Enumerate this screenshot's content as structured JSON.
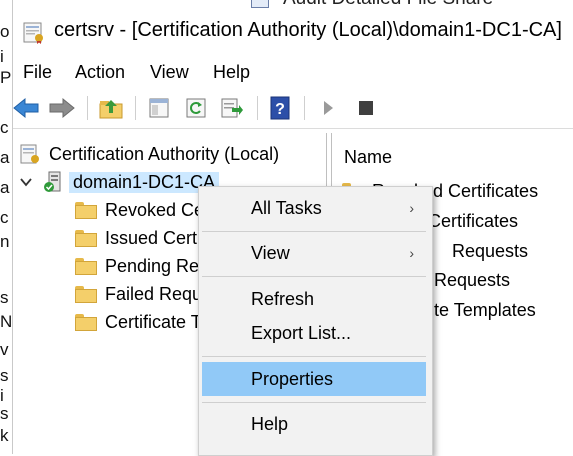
{
  "background": {
    "left_edge_letters": [
      "o",
      "i",
      "P",
      "c",
      "a",
      "a",
      "c",
      "n",
      "s",
      "N",
      "v",
      "s",
      "i",
      "s",
      "k"
    ],
    "top_peek_text": "Audit Detailed File Share"
  },
  "window": {
    "title": "certsrv - [Certification Authority (Local)\\domain1-DC1-CA]"
  },
  "menubar": {
    "items": [
      "File",
      "Action",
      "View",
      "Help"
    ]
  },
  "toolbar": {
    "buttons": [
      "back-arrow",
      "forward-arrow",
      "up-folder",
      "show-hide-console-tree",
      "refresh",
      "export-list",
      "help",
      "start-service",
      "stop-service"
    ]
  },
  "tree": {
    "root": "Certification Authority (Local)",
    "ca": "domain1-DC1-CA",
    "children": [
      "Revoked Ce",
      "Issued Certi",
      "Pending Re",
      "Failed Requ",
      "Certificate T"
    ]
  },
  "list": {
    "column_header": "Name",
    "rows": [
      "Revoked Certificates",
      "Certificates",
      "Requests",
      "Requests",
      "te Templates"
    ]
  },
  "context_menu": {
    "items": [
      {
        "label": "All Tasks",
        "submenu": true
      },
      {
        "label": "View",
        "submenu": true
      },
      {
        "label": "Refresh",
        "submenu": false
      },
      {
        "label": "Export List...",
        "submenu": false
      },
      {
        "label": "Properties",
        "submenu": false,
        "highlighted": true
      },
      {
        "label": "Help",
        "submenu": false
      }
    ],
    "submenu_arrow": "›"
  },
  "colors": {
    "selection": "#cce8ff",
    "menu_highlight": "#91c9f7",
    "menu_bg": "#f2f2f2",
    "folder": "#f4cf6a"
  }
}
